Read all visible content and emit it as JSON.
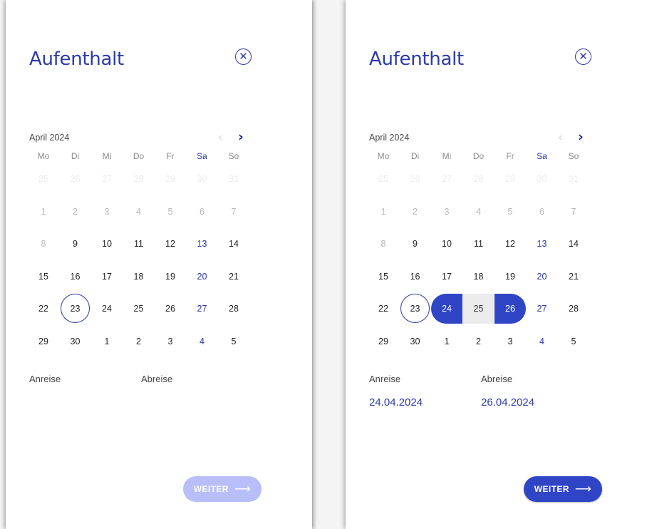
{
  "colors": {
    "accent": "#2b3aad",
    "selected": "#2f45c6",
    "disabled_button": "#b7befa",
    "range_fill": "#ebebeb"
  },
  "icons": {
    "close": "close-circle-icon",
    "prev": "chevron-left-icon",
    "next": "chevron-right-icon",
    "button_arrow": "arrow-right-icon"
  },
  "panels": [
    {
      "title": "Aufenthalt",
      "month": "April 2024",
      "weekdays": [
        "Mo",
        "Di",
        "Mi",
        "Do",
        "Fr",
        "Sa",
        "So"
      ],
      "rows": [
        [
          {
            "t": "25",
            "s": "ghost"
          },
          {
            "t": "26",
            "s": "ghost"
          },
          {
            "t": "27",
            "s": "ghost"
          },
          {
            "t": "28",
            "s": "ghost"
          },
          {
            "t": "29",
            "s": "ghost"
          },
          {
            "t": "30",
            "s": "ghost"
          },
          {
            "t": "31",
            "s": "ghost"
          }
        ],
        [
          {
            "t": "1",
            "s": "faded"
          },
          {
            "t": "2",
            "s": "faded"
          },
          {
            "t": "3",
            "s": "faded"
          },
          {
            "t": "4",
            "s": "faded"
          },
          {
            "t": "5",
            "s": "faded"
          },
          {
            "t": "6",
            "s": "faded"
          },
          {
            "t": "7",
            "s": "faded"
          }
        ],
        [
          {
            "t": "8",
            "s": "faded"
          },
          {
            "t": "9",
            "s": ""
          },
          {
            "t": "10",
            "s": ""
          },
          {
            "t": "11",
            "s": ""
          },
          {
            "t": "12",
            "s": ""
          },
          {
            "t": "13",
            "s": "sat"
          },
          {
            "t": "14",
            "s": ""
          }
        ],
        [
          {
            "t": "15",
            "s": ""
          },
          {
            "t": "16",
            "s": ""
          },
          {
            "t": "17",
            "s": ""
          },
          {
            "t": "18",
            "s": ""
          },
          {
            "t": "19",
            "s": ""
          },
          {
            "t": "20",
            "s": "sat"
          },
          {
            "t": "21",
            "s": ""
          }
        ],
        [
          {
            "t": "22",
            "s": ""
          },
          {
            "t": "23",
            "s": "today"
          },
          {
            "t": "24",
            "s": ""
          },
          {
            "t": "25",
            "s": ""
          },
          {
            "t": "26",
            "s": ""
          },
          {
            "t": "27",
            "s": "sat"
          },
          {
            "t": "28",
            "s": ""
          }
        ],
        [
          {
            "t": "29",
            "s": ""
          },
          {
            "t": "30",
            "s": ""
          },
          {
            "t": "1",
            "s": ""
          },
          {
            "t": "2",
            "s": ""
          },
          {
            "t": "3",
            "s": ""
          },
          {
            "t": "4",
            "s": "sat"
          },
          {
            "t": "5",
            "s": ""
          }
        ]
      ],
      "arrival_label": "Anreise",
      "departure_label": "Abreise",
      "arrival_value": "",
      "departure_value": "",
      "button_label": "WEITER",
      "button_state": "disabled"
    },
    {
      "title": "Aufenthalt",
      "month": "April 2024",
      "weekdays": [
        "Mo",
        "Di",
        "Mi",
        "Do",
        "Fr",
        "Sa",
        "So"
      ],
      "rows": [
        [
          {
            "t": "25",
            "s": "ghost"
          },
          {
            "t": "26",
            "s": "ghost"
          },
          {
            "t": "27",
            "s": "ghost"
          },
          {
            "t": "28",
            "s": "ghost"
          },
          {
            "t": "29",
            "s": "ghost"
          },
          {
            "t": "30",
            "s": "ghost"
          },
          {
            "t": "31",
            "s": "ghost"
          }
        ],
        [
          {
            "t": "1",
            "s": "faded"
          },
          {
            "t": "2",
            "s": "faded"
          },
          {
            "t": "3",
            "s": "faded"
          },
          {
            "t": "4",
            "s": "faded"
          },
          {
            "t": "5",
            "s": "faded"
          },
          {
            "t": "6",
            "s": "faded"
          },
          {
            "t": "7",
            "s": "faded"
          }
        ],
        [
          {
            "t": "8",
            "s": "faded"
          },
          {
            "t": "9",
            "s": ""
          },
          {
            "t": "10",
            "s": ""
          },
          {
            "t": "11",
            "s": ""
          },
          {
            "t": "12",
            "s": ""
          },
          {
            "t": "13",
            "s": "sat"
          },
          {
            "t": "14",
            "s": ""
          }
        ],
        [
          {
            "t": "15",
            "s": ""
          },
          {
            "t": "16",
            "s": ""
          },
          {
            "t": "17",
            "s": ""
          },
          {
            "t": "18",
            "s": ""
          },
          {
            "t": "19",
            "s": ""
          },
          {
            "t": "20",
            "s": "sat"
          },
          {
            "t": "21",
            "s": ""
          }
        ],
        [
          {
            "t": "22",
            "s": ""
          },
          {
            "t": "23",
            "s": "today"
          },
          {
            "t": "24",
            "s": "range-start"
          },
          {
            "t": "25",
            "s": "range-mid"
          },
          {
            "t": "26",
            "s": "range-end"
          },
          {
            "t": "27",
            "s": "sat"
          },
          {
            "t": "28",
            "s": ""
          }
        ],
        [
          {
            "t": "29",
            "s": ""
          },
          {
            "t": "30",
            "s": ""
          },
          {
            "t": "1",
            "s": ""
          },
          {
            "t": "2",
            "s": ""
          },
          {
            "t": "3",
            "s": ""
          },
          {
            "t": "4",
            "s": "sat"
          },
          {
            "t": "5",
            "s": ""
          }
        ]
      ],
      "arrival_label": "Anreise",
      "departure_label": "Abreise",
      "arrival_value": "24.04.2024",
      "departure_value": "26.04.2024",
      "button_label": "WEITER",
      "button_state": "enabled"
    }
  ]
}
